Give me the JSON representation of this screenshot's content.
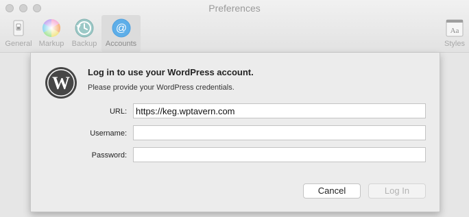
{
  "window": {
    "title": "Preferences"
  },
  "toolbar": {
    "items": [
      {
        "label": "General",
        "icon": "general-switch-icon"
      },
      {
        "label": "Markup",
        "icon": "color-wheel-icon"
      },
      {
        "label": "Backup",
        "icon": "time-machine-icon"
      },
      {
        "label": "Accounts",
        "icon": "at-sign-icon",
        "selected": true
      },
      {
        "label": "Styles",
        "icon": "font-aa-icon"
      }
    ]
  },
  "dialog": {
    "heading": "Log in to use your WordPress account.",
    "subtitle": "Please provide your WordPress credentials.",
    "url_label": "URL:",
    "url_value": "https://keg.wptavern.com",
    "username_label": "Username:",
    "username_value": "",
    "password_label": "Password:",
    "password_value": "",
    "cancel_label": "Cancel",
    "login_label": "Log In"
  },
  "colors": {
    "accent_blue": "#4a9fe0",
    "wordpress_logo": "#464646"
  }
}
